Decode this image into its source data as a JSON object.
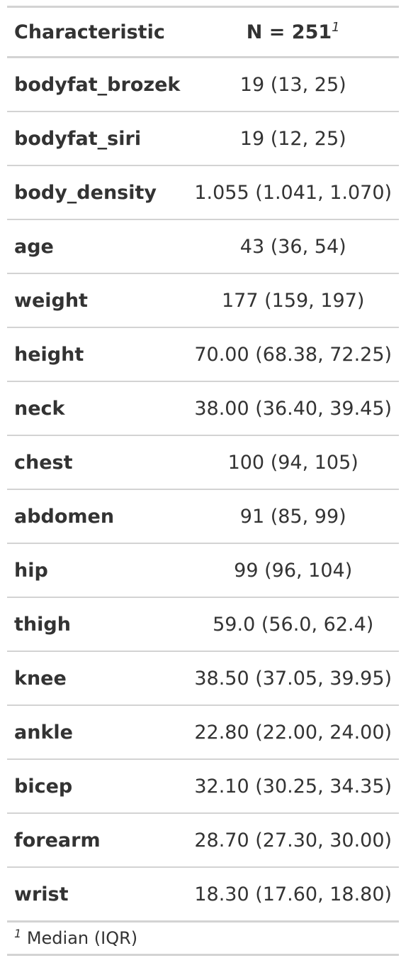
{
  "header": {
    "characteristic": "Characteristic",
    "n_label": "N = 251",
    "footnote_marker": "1"
  },
  "rows": [
    {
      "label": "bodyfat_brozek",
      "value": "19 (13, 25)"
    },
    {
      "label": "bodyfat_siri",
      "value": "19 (12, 25)"
    },
    {
      "label": "body_density",
      "value": "1.055 (1.041, 1.070)"
    },
    {
      "label": "age",
      "value": "43 (36, 54)"
    },
    {
      "label": "weight",
      "value": "177 (159, 197)"
    },
    {
      "label": "height",
      "value": "70.00 (68.38, 72.25)"
    },
    {
      "label": "neck",
      "value": "38.00 (36.40, 39.45)"
    },
    {
      "label": "chest",
      "value": "100 (94, 105)"
    },
    {
      "label": "abdomen",
      "value": "91 (85, 99)"
    },
    {
      "label": "hip",
      "value": "99 (96, 104)"
    },
    {
      "label": "thigh",
      "value": "59.0 (56.0, 62.4)"
    },
    {
      "label": "knee",
      "value": "38.50 (37.05, 39.95)"
    },
    {
      "label": "ankle",
      "value": "22.80 (22.00, 24.00)"
    },
    {
      "label": "bicep",
      "value": "32.10 (30.25, 34.35)"
    },
    {
      "label": "forearm",
      "value": "28.70 (27.30, 30.00)"
    },
    {
      "label": "wrist",
      "value": "18.30 (17.60, 18.80)"
    }
  ],
  "footnote": {
    "marker": "1",
    "text": "Median (IQR)"
  }
}
